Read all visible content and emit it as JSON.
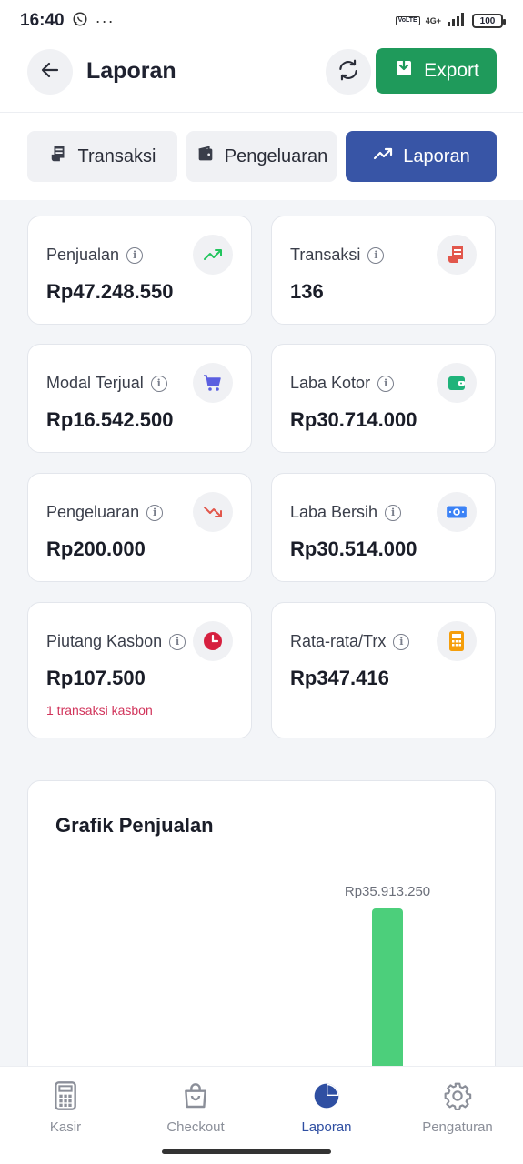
{
  "status_bar": {
    "time": "16:40",
    "dots": "···",
    "network": "4G+",
    "volte": "VoLTE",
    "battery": "100"
  },
  "header": {
    "title": "Laporan",
    "export_label": "Export"
  },
  "tabs": [
    {
      "label": "Transaksi",
      "icon": "receipt-icon",
      "active": false
    },
    {
      "label": "Pengeluaran",
      "icon": "wallet-icon",
      "active": false
    },
    {
      "label": "Laporan",
      "icon": "trend-up-icon",
      "active": true
    }
  ],
  "stats": [
    {
      "label": "Penjualan",
      "value": "Rp47.248.550",
      "icon": "trending-up-icon",
      "color": "#22c55e"
    },
    {
      "label": "Transaksi",
      "value": "136",
      "icon": "receipt-icon",
      "color": "#e2574c"
    },
    {
      "label": "Modal Terjual",
      "value": "Rp16.542.500",
      "icon": "cart-icon",
      "color": "#5b5fe0"
    },
    {
      "label": "Laba Kotor",
      "value": "Rp30.714.000",
      "icon": "wallet-icon",
      "color": "#1fb37a"
    },
    {
      "label": "Pengeluaran",
      "value": "Rp200.000",
      "icon": "trending-down-icon",
      "color": "#e2574c"
    },
    {
      "label": "Laba Bersih",
      "value": "Rp30.514.000",
      "icon": "money-icon",
      "color": "#3b82f6"
    },
    {
      "label": "Piutang Kasbon",
      "value": "Rp107.500",
      "icon": "clock-icon",
      "color": "#d6203f",
      "note": "1 transaksi kasbon"
    },
    {
      "label": "Rata-rata/Trx",
      "value": "Rp347.416",
      "icon": "calculator-icon",
      "color": "#f59e0b"
    }
  ],
  "chart": {
    "title": "Grafik Penjualan",
    "bar_color": "#4ccf7b"
  },
  "chart_data": {
    "type": "bar",
    "categories": [
      ""
    ],
    "values": [
      35913250
    ],
    "data_labels": [
      "Rp35.913.250"
    ]
  },
  "bottom_nav": [
    {
      "label": "Kasir",
      "icon": "calculator-icon",
      "active": false
    },
    {
      "label": "Checkout",
      "icon": "shopping-bag-icon",
      "active": false
    },
    {
      "label": "Laporan",
      "icon": "pie-chart-icon",
      "active": true
    },
    {
      "label": "Pengaturan",
      "icon": "gear-icon",
      "active": false
    }
  ]
}
